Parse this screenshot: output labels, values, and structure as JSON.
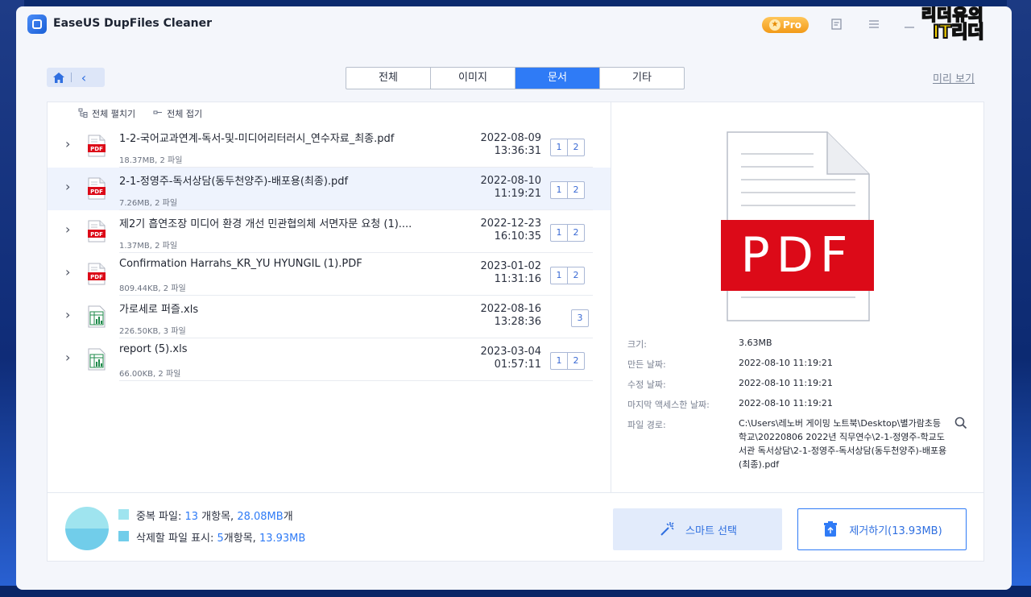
{
  "app": {
    "title": "EaseUS DupFiles Cleaner",
    "pro_label": "Pro"
  },
  "watermark": {
    "line1": "리더유의",
    "line2": "IT리더"
  },
  "tabs": [
    {
      "label": "전체"
    },
    {
      "label": "이미지"
    },
    {
      "label": "문서",
      "active": true
    },
    {
      "label": "기타"
    }
  ],
  "preview_link": "미리 보기",
  "list_toolbar": {
    "expand_all": "전체 펼치기",
    "collapse_all": "전체 접기"
  },
  "files": [
    {
      "name": "1-2-국어교과연계-독서-및-미디어리터러시_연수자료_최종.pdf",
      "meta": "18.37MB, 2 파일",
      "date": "2022-08-09",
      "time": "13:36:31",
      "type": "pdf",
      "copies": [
        "1",
        "2"
      ]
    },
    {
      "name": "2-1-정영주-독서상담(동두천양주)-배포용(최종).pdf",
      "meta": "7.26MB, 2 파일",
      "date": "2022-08-10",
      "time": "11:19:21",
      "type": "pdf",
      "copies": [
        "1",
        "2"
      ],
      "selected": true
    },
    {
      "name": "제2기 흡연조장 미디어 환경 개선 민관협의체 서면자문 요청 (1)....",
      "meta": "1.37MB, 2 파일",
      "date": "2022-12-23",
      "time": "16:10:35",
      "type": "pdf",
      "copies": [
        "1",
        "2"
      ]
    },
    {
      "name": "Confirmation Harrahs_KR_YU HYUNGIL (1).PDF",
      "meta": "809.44KB, 2 파일",
      "date": "2023-01-02",
      "time": "11:31:16",
      "type": "pdf",
      "copies": [
        "1",
        "2"
      ]
    },
    {
      "name": "가로세로 퍼즐.xls",
      "meta": "226.50KB, 3 파일",
      "date": "2022-08-16",
      "time": "13:28:36",
      "type": "xls",
      "copies": [
        "3"
      ]
    },
    {
      "name": "report (5).xls",
      "meta": "66.00KB, 2 파일",
      "date": "2023-03-04",
      "time": "01:57:11",
      "type": "xls",
      "copies": [
        "1",
        "2"
      ]
    }
  ],
  "preview": {
    "big_icon_label": "PDF",
    "size_label": "크기:",
    "size_value": "3.63MB",
    "created_label": "만든 날짜:",
    "created_value": "2022-08-10 11:19:21",
    "modified_label": "수정 날짜:",
    "modified_value": "2022-08-10 11:19:21",
    "accessed_label": "마지막 액세스한 날짜:",
    "accessed_value": "2022-08-10 11:19:21",
    "path_label": "파일 경로:",
    "path_value": "C:\\Users\\레노버 게이밍 노트북\\Desktop\\별가람초등학교\\20220806 2022년 직무연수\\2-1-정영주-학교도서관 독서상담\\2-1-정영주-독서상담(동두천양주)-배포용(최종).pdf"
  },
  "summary": {
    "dup_label": "중복 파일: ",
    "dup_count": "13",
    "dup_mid": " 개항목, ",
    "dup_size": "28.08MB",
    "dup_tail": "개",
    "del_label": "삭제할 파일 표시: ",
    "del_count": "5",
    "del_mid": "개항목, ",
    "del_size": "13.93MB",
    "dup_fraction": 0.5,
    "colors": {
      "dup": "#9fe4ef",
      "del": "#71cdea"
    }
  },
  "buttons": {
    "smart_select": "스마트 선택",
    "remove": "제거하기(13.93MB)"
  },
  "colors": {
    "accent": "#2f7bf6",
    "pdf_red": "#dc0a18"
  }
}
